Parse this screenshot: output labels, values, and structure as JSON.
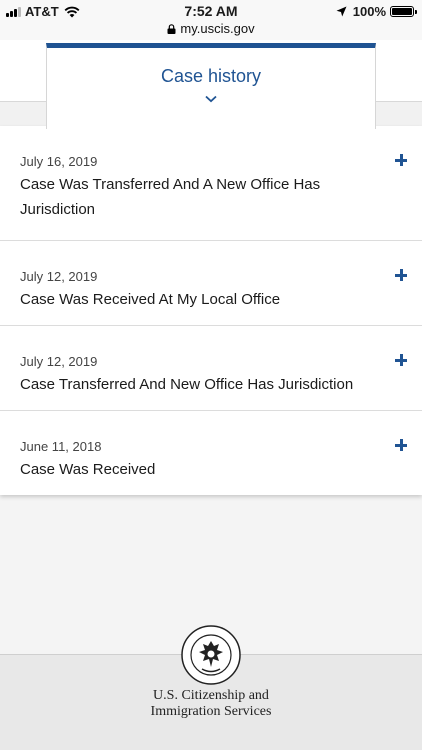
{
  "status_bar": {
    "carrier": "AT&T",
    "time": "7:52 AM",
    "url": "my.uscis.gov",
    "battery": "100%",
    "battery_level": 1.0
  },
  "tab": {
    "title": "Case history"
  },
  "history": [
    {
      "date": "July 16, 2019",
      "event": "Case Was Transferred And A New Office Has Jurisdiction"
    },
    {
      "date": "July 12, 2019",
      "event": "Case Was Received At My Local Office"
    },
    {
      "date": "July 12, 2019",
      "event": "Case Transferred And New Office Has Jurisdiction"
    },
    {
      "date": "June 11, 2018",
      "event": "Case Was Received"
    }
  ],
  "footer": {
    "agency_line1": "U.S. Citizenship and",
    "agency_line2": "Immigration Services",
    "seal_text": "U.S. DEPARTMENT OF HOMELAND SECURITY"
  },
  "colors": {
    "accent": "#205493",
    "background": "#f1f1f1",
    "card": "#ffffff"
  },
  "icons": [
    "signal-icon",
    "wifi-icon",
    "lock-icon",
    "location-icon",
    "battery-icon",
    "chevron-down-icon",
    "plus-icon",
    "dhs-seal-icon"
  ]
}
